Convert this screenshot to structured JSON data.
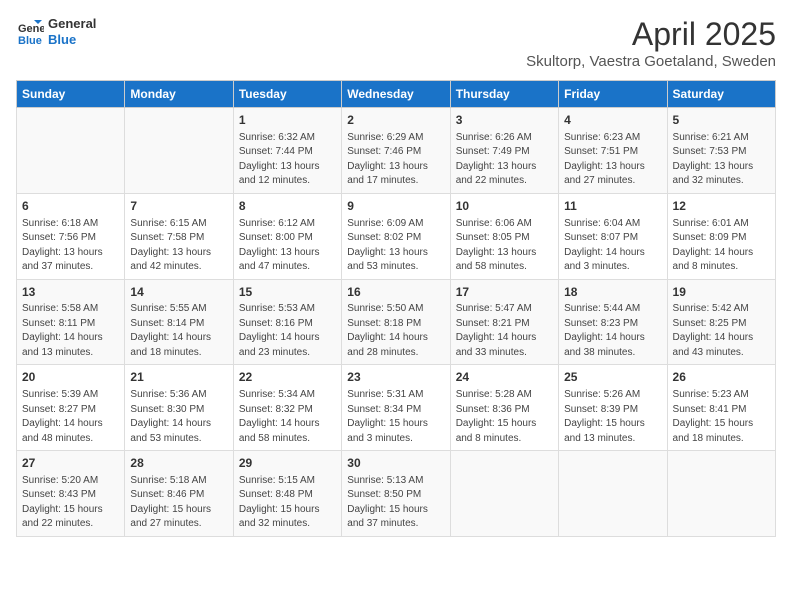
{
  "header": {
    "logo_line1": "General",
    "logo_line2": "Blue",
    "main_title": "April 2025",
    "subtitle": "Skultorp, Vaestra Goetaland, Sweden"
  },
  "days_of_week": [
    "Sunday",
    "Monday",
    "Tuesday",
    "Wednesday",
    "Thursday",
    "Friday",
    "Saturday"
  ],
  "weeks": [
    [
      {
        "day": "",
        "info": ""
      },
      {
        "day": "",
        "info": ""
      },
      {
        "day": "1",
        "info": "Sunrise: 6:32 AM\nSunset: 7:44 PM\nDaylight: 13 hours and 12 minutes."
      },
      {
        "day": "2",
        "info": "Sunrise: 6:29 AM\nSunset: 7:46 PM\nDaylight: 13 hours and 17 minutes."
      },
      {
        "day": "3",
        "info": "Sunrise: 6:26 AM\nSunset: 7:49 PM\nDaylight: 13 hours and 22 minutes."
      },
      {
        "day": "4",
        "info": "Sunrise: 6:23 AM\nSunset: 7:51 PM\nDaylight: 13 hours and 27 minutes."
      },
      {
        "day": "5",
        "info": "Sunrise: 6:21 AM\nSunset: 7:53 PM\nDaylight: 13 hours and 32 minutes."
      }
    ],
    [
      {
        "day": "6",
        "info": "Sunrise: 6:18 AM\nSunset: 7:56 PM\nDaylight: 13 hours and 37 minutes."
      },
      {
        "day": "7",
        "info": "Sunrise: 6:15 AM\nSunset: 7:58 PM\nDaylight: 13 hours and 42 minutes."
      },
      {
        "day": "8",
        "info": "Sunrise: 6:12 AM\nSunset: 8:00 PM\nDaylight: 13 hours and 47 minutes."
      },
      {
        "day": "9",
        "info": "Sunrise: 6:09 AM\nSunset: 8:02 PM\nDaylight: 13 hours and 53 minutes."
      },
      {
        "day": "10",
        "info": "Sunrise: 6:06 AM\nSunset: 8:05 PM\nDaylight: 13 hours and 58 minutes."
      },
      {
        "day": "11",
        "info": "Sunrise: 6:04 AM\nSunset: 8:07 PM\nDaylight: 14 hours and 3 minutes."
      },
      {
        "day": "12",
        "info": "Sunrise: 6:01 AM\nSunset: 8:09 PM\nDaylight: 14 hours and 8 minutes."
      }
    ],
    [
      {
        "day": "13",
        "info": "Sunrise: 5:58 AM\nSunset: 8:11 PM\nDaylight: 14 hours and 13 minutes."
      },
      {
        "day": "14",
        "info": "Sunrise: 5:55 AM\nSunset: 8:14 PM\nDaylight: 14 hours and 18 minutes."
      },
      {
        "day": "15",
        "info": "Sunrise: 5:53 AM\nSunset: 8:16 PM\nDaylight: 14 hours and 23 minutes."
      },
      {
        "day": "16",
        "info": "Sunrise: 5:50 AM\nSunset: 8:18 PM\nDaylight: 14 hours and 28 minutes."
      },
      {
        "day": "17",
        "info": "Sunrise: 5:47 AM\nSunset: 8:21 PM\nDaylight: 14 hours and 33 minutes."
      },
      {
        "day": "18",
        "info": "Sunrise: 5:44 AM\nSunset: 8:23 PM\nDaylight: 14 hours and 38 minutes."
      },
      {
        "day": "19",
        "info": "Sunrise: 5:42 AM\nSunset: 8:25 PM\nDaylight: 14 hours and 43 minutes."
      }
    ],
    [
      {
        "day": "20",
        "info": "Sunrise: 5:39 AM\nSunset: 8:27 PM\nDaylight: 14 hours and 48 minutes."
      },
      {
        "day": "21",
        "info": "Sunrise: 5:36 AM\nSunset: 8:30 PM\nDaylight: 14 hours and 53 minutes."
      },
      {
        "day": "22",
        "info": "Sunrise: 5:34 AM\nSunset: 8:32 PM\nDaylight: 14 hours and 58 minutes."
      },
      {
        "day": "23",
        "info": "Sunrise: 5:31 AM\nSunset: 8:34 PM\nDaylight: 15 hours and 3 minutes."
      },
      {
        "day": "24",
        "info": "Sunrise: 5:28 AM\nSunset: 8:36 PM\nDaylight: 15 hours and 8 minutes."
      },
      {
        "day": "25",
        "info": "Sunrise: 5:26 AM\nSunset: 8:39 PM\nDaylight: 15 hours and 13 minutes."
      },
      {
        "day": "26",
        "info": "Sunrise: 5:23 AM\nSunset: 8:41 PM\nDaylight: 15 hours and 18 minutes."
      }
    ],
    [
      {
        "day": "27",
        "info": "Sunrise: 5:20 AM\nSunset: 8:43 PM\nDaylight: 15 hours and 22 minutes."
      },
      {
        "day": "28",
        "info": "Sunrise: 5:18 AM\nSunset: 8:46 PM\nDaylight: 15 hours and 27 minutes."
      },
      {
        "day": "29",
        "info": "Sunrise: 5:15 AM\nSunset: 8:48 PM\nDaylight: 15 hours and 32 minutes."
      },
      {
        "day": "30",
        "info": "Sunrise: 5:13 AM\nSunset: 8:50 PM\nDaylight: 15 hours and 37 minutes."
      },
      {
        "day": "",
        "info": ""
      },
      {
        "day": "",
        "info": ""
      },
      {
        "day": "",
        "info": ""
      }
    ]
  ]
}
